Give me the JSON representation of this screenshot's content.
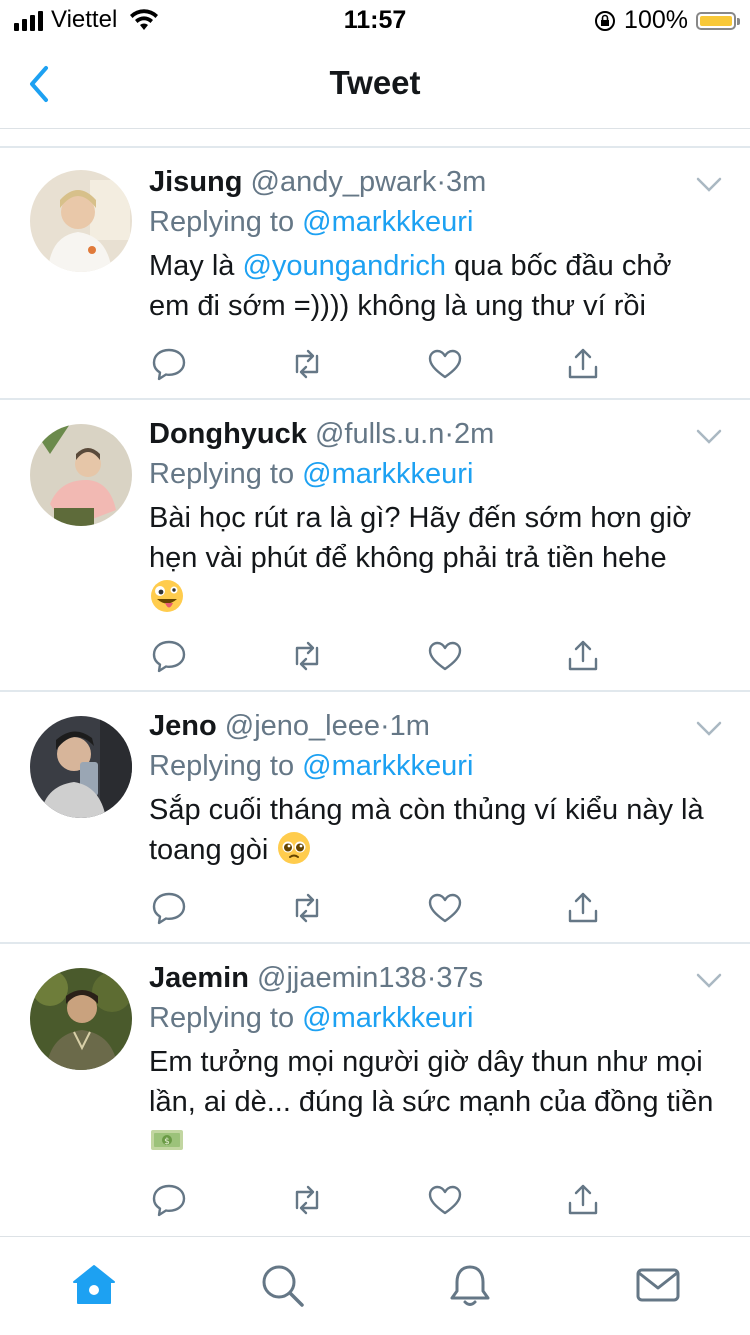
{
  "status_bar": {
    "carrier": "Viettel",
    "time": "11:57",
    "battery": "100%"
  },
  "nav": {
    "title": "Tweet",
    "back_icon": "chevron-left-icon"
  },
  "colors": {
    "accent": "#1da1f2",
    "text": "#14171a",
    "muted": "#657786",
    "divider": "#e1e8ed",
    "battery": "#f8c838"
  },
  "replying_label": "Replying to",
  "tweets": [
    {
      "name": "Jisung",
      "handle": "@andy_pwark",
      "dot": "·",
      "time": "3m",
      "reply_to": "@markkkeuri",
      "text_part1": "May là ",
      "text_mention": "@youngandrich",
      "text_part2": " qua bốc đầu chở em đi sớm =)))) không là ung thư ví rồi"
    },
    {
      "name": "Donghyuck",
      "handle": "@fulls.u.n",
      "dot": "·",
      "time": "2m",
      "reply_to": "@markkkeuri",
      "text": "Bài học rút ra là gì? Hãy đến sớm hơn giờ hẹn vài phút để không phải trả tiền hehe",
      "emoji": "zany-face"
    },
    {
      "name": "Jeno",
      "handle": "@jeno_leee",
      "dot": "·",
      "time": "1m",
      "reply_to": "@markkkeuri",
      "text": "Sắp cuối tháng mà còn thủng ví kiểu này là toang gòi",
      "emoji": "pleading-face"
    },
    {
      "name": "Jaemin",
      "handle": "@jjaemin138",
      "dot": "·",
      "time": "37s",
      "reply_to": "@markkkeuri",
      "text": "Em tưởng mọi người giờ dây thun như mọi lần, ai dè... đúng là sức mạnh của đồng tiền",
      "emoji": "money-with-wings"
    }
  ],
  "action_icons": [
    "reply-icon",
    "retweet-icon",
    "like-icon",
    "share-icon"
  ],
  "tab_bar": [
    "home-icon",
    "search-icon",
    "notifications-icon",
    "messages-icon"
  ]
}
